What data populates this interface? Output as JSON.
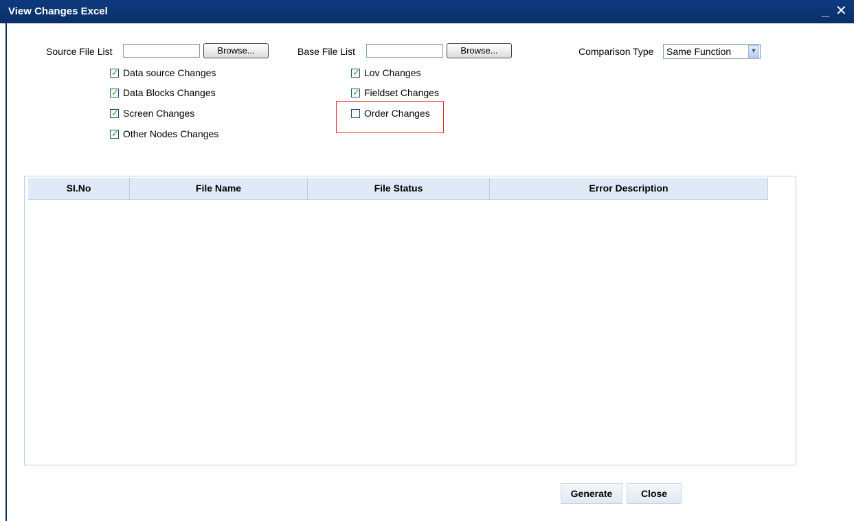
{
  "window": {
    "title": "View Changes Excel",
    "minimize_glyph": "_",
    "close_glyph": "✕"
  },
  "form": {
    "source_file_list": {
      "label": "Source File List",
      "value": "",
      "browse_label": "Browse..."
    },
    "base_file_list": {
      "label": "Base File List",
      "value": "",
      "browse_label": "Browse..."
    },
    "comparison_type": {
      "label": "Comparison Type",
      "selected": "Same Function"
    },
    "checkboxes": [
      {
        "label": "Data source Changes",
        "checked": true
      },
      {
        "label": "Data Blocks Changes",
        "checked": true
      },
      {
        "label": "Screen Changes",
        "checked": true
      },
      {
        "label": "Other Nodes Changes",
        "checked": true
      },
      {
        "label": "Lov Changes",
        "checked": true
      },
      {
        "label": "Fieldset Changes",
        "checked": true
      },
      {
        "label": "Order Changes",
        "checked": false
      }
    ]
  },
  "grid": {
    "columns": [
      "SI.No",
      "File Name",
      "File Status",
      "Error Description"
    ],
    "rows": []
  },
  "footer": {
    "generate_label": "Generate",
    "close_label": "Close"
  },
  "colors": {
    "titlebar": "#0a2f66",
    "grid_header": "#dfeaf6",
    "highlight": "#e03030",
    "check": "#21a121"
  }
}
